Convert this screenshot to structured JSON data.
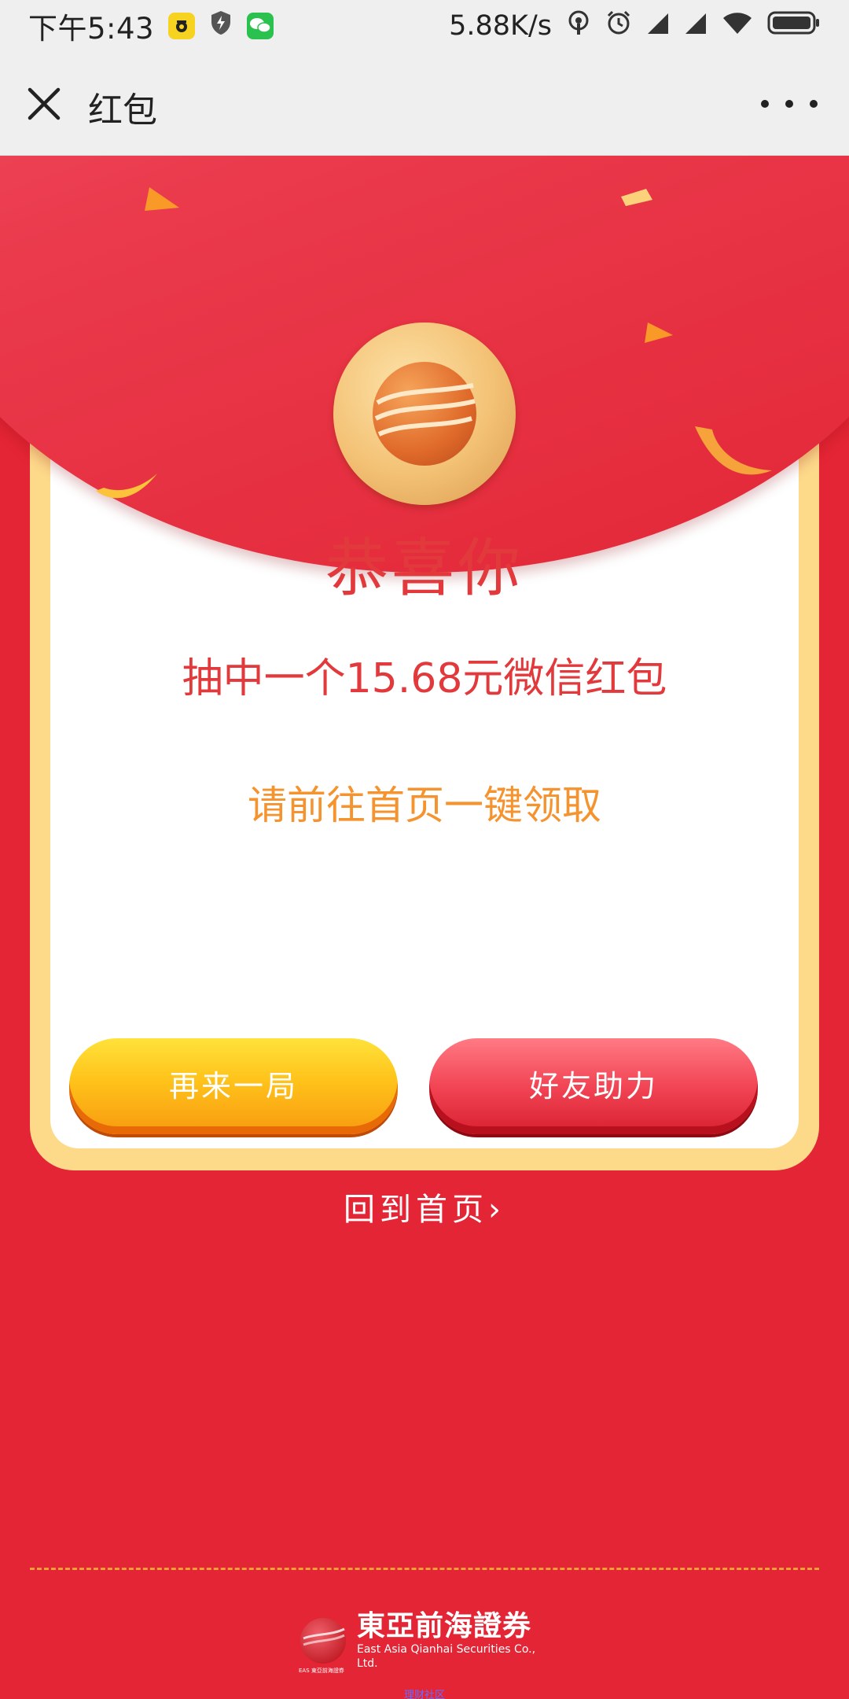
{
  "status_bar": {
    "time": "下午5:43",
    "network_speed": "5.88K/s",
    "icons": [
      "notification-app-icon",
      "shield-bolt-icon",
      "wechat-icon",
      "hotspot-icon",
      "alarm-icon",
      "signal-icon",
      "signal-icon",
      "wifi-icon",
      "battery-icon"
    ]
  },
  "title_bar": {
    "title": "红包"
  },
  "card": {
    "headline": "恭喜你",
    "prize": "抽中一个15.68元微信红包",
    "hint": "请前往首页一键领取"
  },
  "buttons": {
    "play_again": "再来一局",
    "friend_help": "好友助力"
  },
  "back_home": "回到首页",
  "back_home_arrow": "›",
  "footer": {
    "brand_cn": "東亞前海證券",
    "brand_en": "East Asia Qianhai Securities Co., Ltd.",
    "brand_abbr": "EAS 東亞前海證券",
    "note": "理财社区"
  },
  "colors": {
    "background_red": "#e42535",
    "card_frame": "#fdd98a",
    "headline_red": "#e23a3c",
    "hint_orange": "#f5932f",
    "button_yellow": "#ffc21a",
    "button_red": "#f24555"
  }
}
